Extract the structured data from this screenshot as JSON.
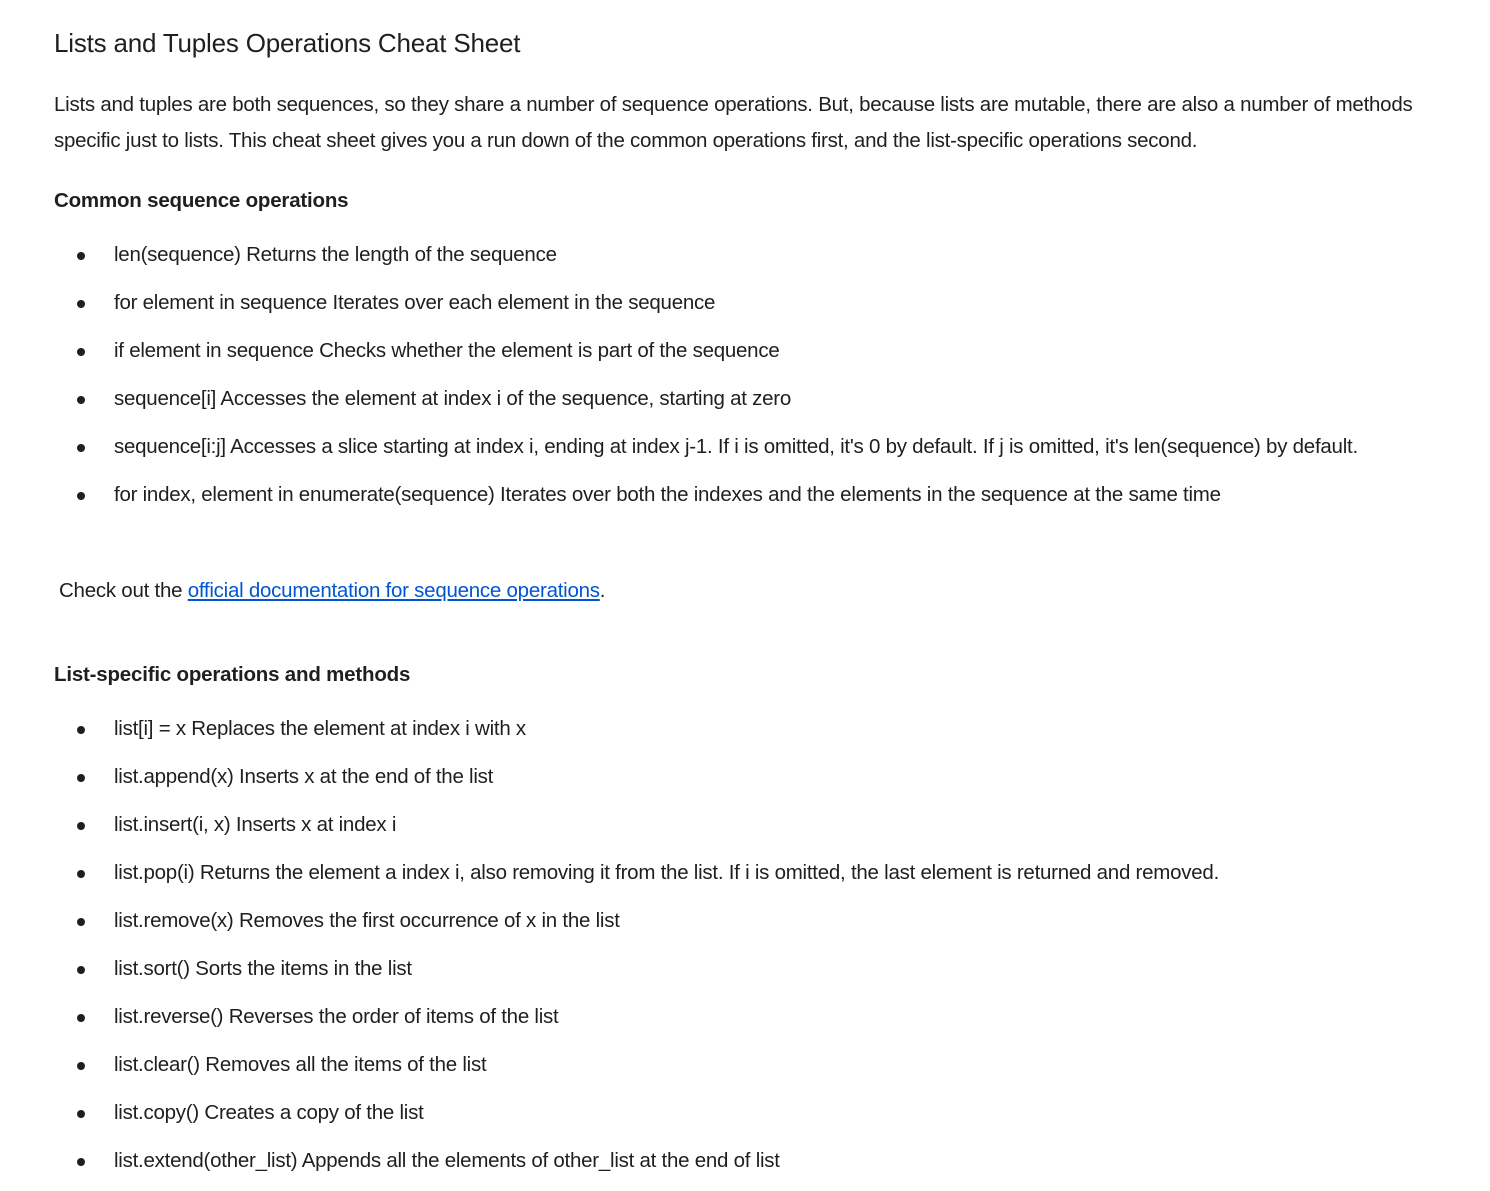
{
  "title": "Lists and Tuples Operations Cheat Sheet",
  "intro": "Lists and tuples are both sequences, so they share a number of sequence operations. But, because lists are mutable, there are also a number of methods specific just to lists. This cheat sheet gives you a run down of the common operations first, and the list-specific operations second.",
  "common": {
    "heading": "Common sequence operations",
    "items": [
      "len(sequence) Returns the length of the sequence",
      "for element in sequence Iterates over each element in the sequence",
      "if element in sequence Checks whether the element is part of the sequence",
      "sequence[i] Accesses the element at index i of the sequence, starting at zero",
      "sequence[i:j] Accesses a slice starting at index i, ending at index j-1. If i is omitted, it's 0 by default. If j is omitted, it's len(sequence) by default.",
      "for index, element in enumerate(sequence) Iterates over both the indexes and the elements in the sequence at the same time"
    ]
  },
  "docs": {
    "prefix": "Check out the ",
    "link_text": "official documentation for sequence operations",
    "suffix": "."
  },
  "list_specific": {
    "heading": "List-specific operations and methods",
    "items": [
      "list[i] = x Replaces the element at index i with x",
      "list.append(x) Inserts x at the end of the list",
      "list.insert(i, x) Inserts x at index i",
      "list.pop(i) Returns the element a index i, also removing it from the list. If i is omitted, the last element is returned and removed.",
      "list.remove(x) Removes the first occurrence of x in the list",
      "list.sort() Sorts the items in the list",
      "list.reverse() Reverses the order of items of the list",
      "list.clear() Removes all the items of the list",
      "list.copy() Creates a copy of the list",
      "list.extend(other_list) Appends all the elements of other_list at the end of list"
    ]
  },
  "colors": {
    "text": "#1f1f1f",
    "link": "#0056d2",
    "background": "#ffffff"
  }
}
